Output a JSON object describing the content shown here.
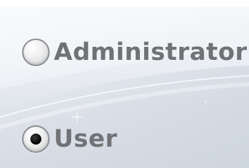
{
  "login_role": {
    "options": [
      {
        "label": "Administrator",
        "selected": false
      },
      {
        "label": "User",
        "selected": true
      }
    ]
  }
}
